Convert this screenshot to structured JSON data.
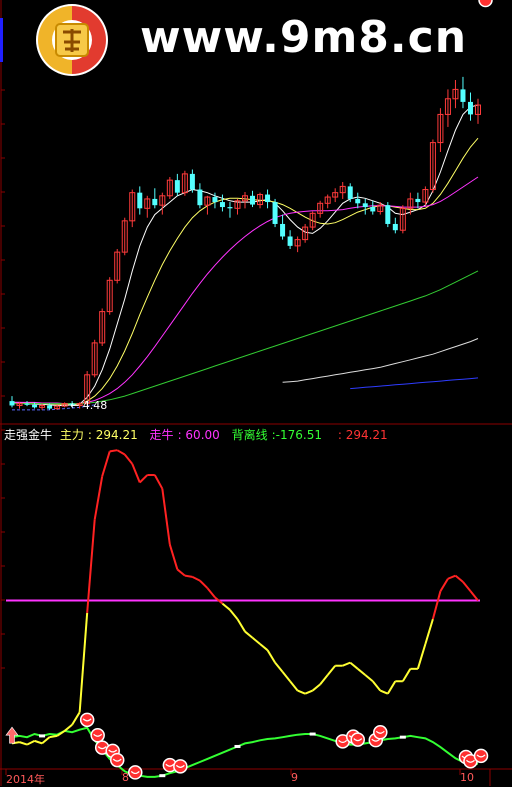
{
  "watermark": {
    "text": "www.9m8.cn"
  },
  "chart_data": [
    {
      "type": "candlestick",
      "panel": "price",
      "annotation": "4.48",
      "candles": [
        [
          4.62,
          4.7,
          4.52,
          4.55
        ],
        [
          4.55,
          4.6,
          4.5,
          4.58
        ],
        [
          4.58,
          4.62,
          4.54,
          4.56
        ],
        [
          4.56,
          4.6,
          4.5,
          4.52
        ],
        [
          4.52,
          4.58,
          4.48,
          4.55
        ],
        [
          4.55,
          4.58,
          4.48,
          4.5
        ],
        [
          4.5,
          4.56,
          4.48,
          4.54
        ],
        [
          4.54,
          4.6,
          4.52,
          4.58
        ],
        [
          4.58,
          4.62,
          4.52,
          4.55
        ],
        [
          4.55,
          4.6,
          4.5,
          4.58
        ],
        [
          4.58,
          5.1,
          4.56,
          5.04
        ],
        [
          5.04,
          5.6,
          5.0,
          5.55
        ],
        [
          5.55,
          6.1,
          5.5,
          6.05
        ],
        [
          6.05,
          6.6,
          6.0,
          6.55
        ],
        [
          6.55,
          7.05,
          6.5,
          7.0
        ],
        [
          7.0,
          7.55,
          6.95,
          7.5
        ],
        [
          7.5,
          8.0,
          7.4,
          7.95
        ],
        [
          7.95,
          8.05,
          7.6,
          7.7
        ],
        [
          7.7,
          7.9,
          7.55,
          7.85
        ],
        [
          7.85,
          8.02,
          7.7,
          7.75
        ],
        [
          7.75,
          7.95,
          7.6,
          7.9
        ],
        [
          7.9,
          8.2,
          7.85,
          8.15
        ],
        [
          8.15,
          8.25,
          7.9,
          7.95
        ],
        [
          7.95,
          8.3,
          7.9,
          8.25
        ],
        [
          8.25,
          8.32,
          7.95,
          8.0
        ],
        [
          8.0,
          8.1,
          7.7,
          7.75
        ],
        [
          7.75,
          7.9,
          7.6,
          7.88
        ],
        [
          7.88,
          7.95,
          7.7,
          7.8
        ],
        [
          7.8,
          7.92,
          7.65,
          7.72
        ],
        [
          7.72,
          7.8,
          7.55,
          7.7
        ],
        [
          7.7,
          7.85,
          7.6,
          7.82
        ],
        [
          7.82,
          7.96,
          7.7,
          7.9
        ],
        [
          7.9,
          7.98,
          7.72,
          7.76
        ],
        [
          7.76,
          7.95,
          7.7,
          7.92
        ],
        [
          7.92,
          8.0,
          7.7,
          7.8
        ],
        [
          7.8,
          7.85,
          7.4,
          7.45
        ],
        [
          7.45,
          7.6,
          7.2,
          7.25
        ],
        [
          7.25,
          7.35,
          7.05,
          7.1
        ],
        [
          7.1,
          7.25,
          7.0,
          7.2
        ],
        [
          7.2,
          7.45,
          7.15,
          7.4
        ],
        [
          7.4,
          7.65,
          7.35,
          7.62
        ],
        [
          7.62,
          7.82,
          7.55,
          7.78
        ],
        [
          7.78,
          7.92,
          7.7,
          7.88
        ],
        [
          7.88,
          8.02,
          7.8,
          7.95
        ],
        [
          7.95,
          8.12,
          7.85,
          8.05
        ],
        [
          8.05,
          8.1,
          7.8,
          7.85
        ],
        [
          7.85,
          7.95,
          7.7,
          7.78
        ],
        [
          7.78,
          7.85,
          7.6,
          7.72
        ],
        [
          7.72,
          7.82,
          7.6,
          7.65
        ],
        [
          7.65,
          7.8,
          7.6,
          7.75
        ],
        [
          7.75,
          7.8,
          7.4,
          7.45
        ],
        [
          7.45,
          7.55,
          7.3,
          7.35
        ],
        [
          7.35,
          7.75,
          7.3,
          7.7
        ],
        [
          7.7,
          7.95,
          7.6,
          7.85
        ],
        [
          7.85,
          7.95,
          7.7,
          7.8
        ],
        [
          7.8,
          8.05,
          7.75,
          8.0
        ],
        [
          8.0,
          8.8,
          7.95,
          8.75
        ],
        [
          8.75,
          9.3,
          8.6,
          9.2
        ],
        [
          9.2,
          9.6,
          9.0,
          9.45
        ],
        [
          9.45,
          9.75,
          9.3,
          9.6
        ],
        [
          9.6,
          9.8,
          9.3,
          9.4
        ],
        [
          9.4,
          9.55,
          9.1,
          9.2
        ],
        [
          9.2,
          9.45,
          9.05,
          9.35
        ]
      ],
      "ma_lines": [
        {
          "values": [
            4.6,
            4.59,
            4.58,
            4.57,
            4.57,
            4.56,
            4.55,
            4.55,
            4.56,
            4.57,
            4.68,
            4.86,
            5.12,
            5.45,
            5.85,
            6.25,
            6.7,
            7.1,
            7.4,
            7.6,
            7.7,
            7.8,
            7.9,
            7.95,
            8.0,
            7.98,
            7.95,
            7.9,
            7.86,
            7.82,
            7.8,
            7.8,
            7.8,
            7.82,
            7.84,
            7.78,
            7.66,
            7.52,
            7.4,
            7.32,
            7.3,
            7.38,
            7.5,
            7.64,
            7.78,
            7.85,
            7.88,
            7.86,
            7.82,
            7.78,
            7.72,
            7.62,
            7.6,
            7.64,
            7.68,
            7.75,
            7.98,
            8.28,
            8.62,
            8.95,
            9.2,
            9.32,
            9.35
          ]
        },
        {
          "values": [
            4.6,
            4.6,
            4.59,
            4.59,
            4.58,
            4.58,
            4.57,
            4.57,
            4.57,
            4.57,
            4.62,
            4.7,
            4.82,
            4.98,
            5.18,
            5.42,
            5.7,
            6.0,
            6.28,
            6.55,
            6.8,
            7.02,
            7.22,
            7.4,
            7.55,
            7.66,
            7.74,
            7.8,
            7.84,
            7.86,
            7.86,
            7.85,
            7.84,
            7.83,
            7.82,
            7.8,
            7.76,
            7.7,
            7.63,
            7.56,
            7.5,
            7.46,
            7.45,
            7.47,
            7.52,
            7.58,
            7.64,
            7.68,
            7.72,
            7.74,
            7.74,
            7.72,
            7.7,
            7.68,
            7.68,
            7.7,
            7.78,
            7.92,
            8.1,
            8.3,
            8.5,
            8.68,
            8.82
          ]
        },
        {
          "values": [
            4.6,
            4.6,
            4.6,
            4.6,
            4.59,
            4.59,
            4.59,
            4.58,
            4.58,
            4.58,
            4.6,
            4.63,
            4.68,
            4.74,
            4.82,
            4.92,
            5.04,
            5.18,
            5.33,
            5.49,
            5.66,
            5.83,
            6.0,
            6.17,
            6.34,
            6.5,
            6.65,
            6.79,
            6.92,
            7.04,
            7.15,
            7.25,
            7.34,
            7.42,
            7.49,
            7.55,
            7.59,
            7.62,
            7.64,
            7.65,
            7.66,
            7.66,
            7.66,
            7.67,
            7.68,
            7.7,
            7.72,
            7.73,
            7.74,
            7.74,
            7.74,
            7.73,
            7.72,
            7.72,
            7.72,
            7.73,
            7.76,
            7.81,
            7.88,
            7.96,
            8.04,
            8.12,
            8.2
          ]
        },
        {
          "values": [
            4.58,
            4.58,
            4.58,
            4.58,
            4.58,
            4.58,
            4.58,
            4.58,
            4.58,
            4.58,
            4.59,
            4.6,
            4.62,
            4.64,
            4.67,
            4.7,
            4.74,
            4.78,
            4.82,
            4.86,
            4.9,
            4.94,
            4.98,
            5.02,
            5.06,
            5.1,
            5.14,
            5.18,
            5.22,
            5.26,
            5.3,
            5.34,
            5.38,
            5.42,
            5.46,
            5.5,
            5.54,
            5.58,
            5.62,
            5.66,
            5.7,
            5.74,
            5.78,
            5.82,
            5.86,
            5.9,
            5.94,
            5.98,
            6.02,
            6.06,
            6.1,
            6.14,
            6.18,
            6.22,
            6.26,
            6.3,
            6.35,
            6.4,
            6.46,
            6.52,
            6.58,
            6.64,
            6.7
          ]
        },
        {
          "values": [
            null,
            null,
            null,
            null,
            null,
            null,
            null,
            null,
            null,
            null,
            null,
            null,
            null,
            null,
            null,
            null,
            null,
            null,
            null,
            null,
            null,
            null,
            null,
            null,
            null,
            null,
            null,
            null,
            null,
            null,
            null,
            null,
            null,
            null,
            null,
            null,
            4.92,
            4.93,
            4.94,
            4.96,
            4.98,
            5.0,
            5.02,
            5.04,
            5.06,
            5.08,
            5.1,
            5.12,
            5.14,
            5.16,
            5.19,
            5.22,
            5.25,
            5.28,
            5.31,
            5.34,
            5.37,
            5.41,
            5.45,
            5.49,
            5.53,
            5.57,
            5.62
          ]
        },
        {
          "values": [
            null,
            null,
            null,
            null,
            null,
            null,
            null,
            null,
            null,
            null,
            null,
            null,
            null,
            null,
            null,
            null,
            null,
            null,
            null,
            null,
            null,
            null,
            null,
            null,
            null,
            null,
            null,
            null,
            null,
            null,
            null,
            null,
            null,
            null,
            null,
            null,
            null,
            null,
            null,
            null,
            null,
            null,
            null,
            null,
            null,
            4.82,
            4.83,
            4.84,
            4.85,
            4.86,
            4.87,
            4.88,
            4.89,
            4.9,
            4.91,
            4.92,
            4.93,
            4.94,
            4.95,
            4.96,
            4.97,
            4.98,
            4.99
          ]
        },
        {
          "values": [
            4.48,
            4.48,
            4.48,
            4.48,
            4.48,
            4.48,
            4.49,
            4.5,
            4.51,
            4.52,
            4.54,
            4.56
          ]
        }
      ]
    },
    {
      "type": "line",
      "panel": "indicator",
      "title": "走强金牛",
      "legend": [
        {
          "name": "主力",
          "value": "294.21"
        },
        {
          "name": "走牛",
          "value": "60.00"
        },
        {
          "name": "背离线",
          "value": "-176.51"
        },
        {
          "name": "",
          "value": "294.21"
        }
      ],
      "x_ticks": [
        "2014年",
        "8",
        "9",
        "10"
      ],
      "ylim": [
        -200,
        320
      ],
      "main_force": [
        -170,
        -168,
        -172,
        -166,
        -170,
        -160,
        -158,
        -150,
        -140,
        -120,
        40,
        190,
        260,
        300,
        302,
        295,
        280,
        250,
        262,
        262,
        240,
        150,
        110,
        100,
        98,
        92,
        80,
        65,
        55,
        45,
        30,
        10,
        0,
        -10,
        -20,
        -40,
        -55,
        -70,
        -85,
        -90,
        -85,
        -75,
        -60,
        -45,
        -45,
        -40,
        -50,
        -60,
        -70,
        -85,
        -90,
        -70,
        -70,
        -50,
        -50,
        -10,
        30,
        75,
        95,
        100,
        90,
        75,
        60
      ],
      "bull_line": 60,
      "divergence": [
        -160,
        -158,
        -160,
        -155,
        -158,
        -155,
        -156,
        -150,
        -152,
        -148,
        -145,
        -165,
        -180,
        -195,
        -205,
        -215,
        -220,
        -222,
        -224,
        -224,
        -222,
        -218,
        -215,
        -210,
        -205,
        -200,
        -195,
        -190,
        -185,
        -180,
        -175,
        -170,
        -168,
        -165,
        -163,
        -162,
        -160,
        -158,
        -156,
        -155,
        -155,
        -158,
        -162,
        -166,
        -170,
        -172,
        -172,
        -170,
        -168,
        -165,
        -163,
        -162,
        -160,
        -158,
        -160,
        -162,
        -168,
        -176,
        -185,
        -194,
        -200,
        -202,
        -203
      ],
      "signals": {
        "up_arrow_index": 0,
        "ball_indices": [
          10,
          11,
          12,
          13,
          14,
          16,
          21,
          22,
          44,
          45,
          46,
          48,
          49,
          60,
          61,
          62,
          63
        ]
      }
    }
  ]
}
